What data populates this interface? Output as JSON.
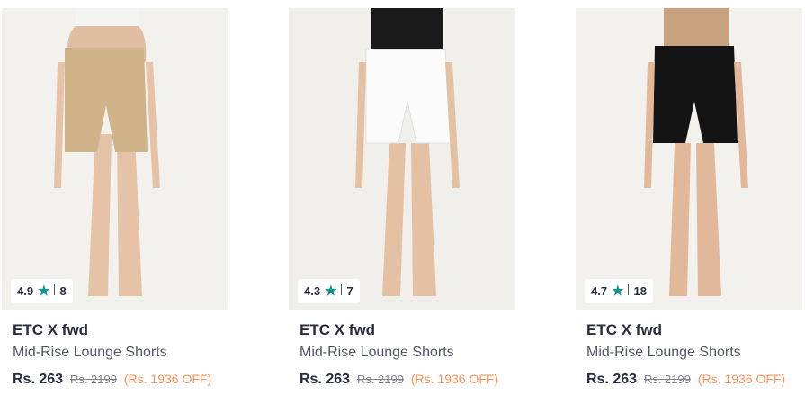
{
  "colors": {
    "rating_star": "#14958f",
    "discount": "#ff905a",
    "brand_text": "#282c3f",
    "muted_text": "#7e818c"
  },
  "products": [
    {
      "rating": "4.9",
      "rating_icon": "star-icon",
      "review_count": "8",
      "brand": "ETC X fwd",
      "name": "Mid-Rise Lounge Shorts",
      "price": "Rs. 263",
      "mrp": "Rs. 2199",
      "discount": "(Rs. 1936 OFF)",
      "shorts_color": "#cfb48a",
      "top_color": "#f4f4f2"
    },
    {
      "rating": "4.3",
      "rating_icon": "star-icon",
      "review_count": "7",
      "brand": "ETC X fwd",
      "name": "Mid-Rise Lounge Shorts",
      "price": "Rs. 263",
      "mrp": "Rs. 2199",
      "discount": "(Rs. 1936 OFF)",
      "shorts_color": "#fbfbfb",
      "top_color": "#1a1a1a"
    },
    {
      "rating": "4.7",
      "rating_icon": "star-icon",
      "review_count": "18",
      "brand": "ETC X fwd",
      "name": "Mid-Rise Lounge Shorts",
      "price": "Rs. 263",
      "mrp": "Rs. 2199",
      "discount": "(Rs. 1936 OFF)",
      "shorts_color": "#141414",
      "top_color": "#c9a27f"
    }
  ]
}
